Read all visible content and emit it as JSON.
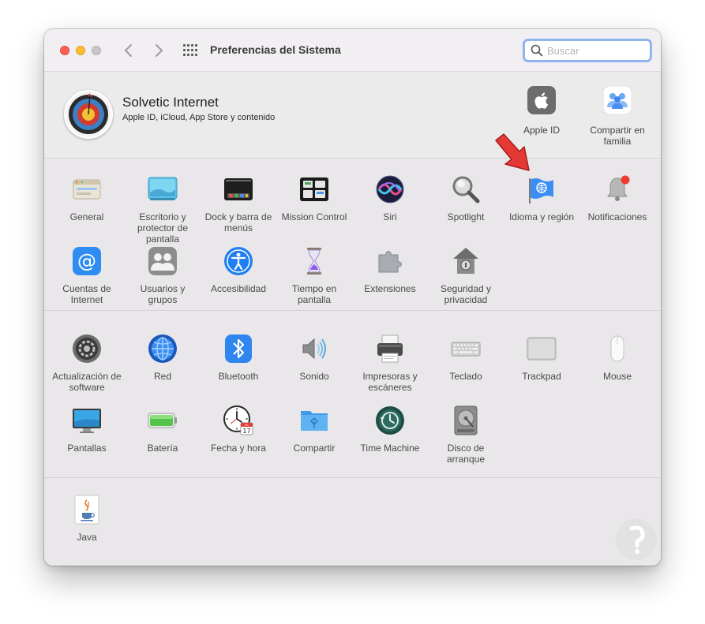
{
  "window": {
    "title": "Preferencias del Sistema",
    "search": {
      "placeholder": "Buscar",
      "value": ""
    }
  },
  "account": {
    "name": "Solvetic Internet",
    "subtitle": "Apple ID, iCloud, App Store y contenido",
    "items": [
      {
        "label": "Apple ID",
        "icon": "apple-icon"
      },
      {
        "label": "Compartir en familia",
        "icon": "family-icon"
      }
    ]
  },
  "sections": [
    {
      "items": [
        {
          "label": "General",
          "icon": "general-icon"
        },
        {
          "label": "Escritorio y protector de pantalla",
          "icon": "desktop-icon"
        },
        {
          "label": "Dock y barra de menús",
          "icon": "dock-icon"
        },
        {
          "label": "Mission Control",
          "icon": "mission-control-icon"
        },
        {
          "label": "Siri",
          "icon": "siri-icon"
        },
        {
          "label": "Spotlight",
          "icon": "spotlight-icon"
        },
        {
          "label": "Idioma y región",
          "icon": "language-region-icon"
        },
        {
          "label": "Notificaciones",
          "icon": "notifications-icon"
        },
        {
          "label": "Cuentas de Internet",
          "icon": "internet-accounts-icon"
        },
        {
          "label": "Usuarios y grupos",
          "icon": "users-groups-icon"
        },
        {
          "label": "Accesibilidad",
          "icon": "accessibility-icon"
        },
        {
          "label": "Tiempo en pantalla",
          "icon": "screen-time-icon"
        },
        {
          "label": "Extensiones",
          "icon": "extensions-icon"
        },
        {
          "label": "Seguridad y privacidad",
          "icon": "security-icon"
        }
      ]
    },
    {
      "items": [
        {
          "label": "Actualización de software",
          "icon": "software-update-icon"
        },
        {
          "label": "Red",
          "icon": "network-icon"
        },
        {
          "label": "Bluetooth",
          "icon": "bluetooth-icon"
        },
        {
          "label": "Sonido",
          "icon": "sound-icon"
        },
        {
          "label": "Impresoras y escáneres",
          "icon": "printer-icon"
        },
        {
          "label": "Teclado",
          "icon": "keyboard-icon"
        },
        {
          "label": "Trackpad",
          "icon": "trackpad-icon"
        },
        {
          "label": "Mouse",
          "icon": "mouse-icon"
        },
        {
          "label": "Pantallas",
          "icon": "displays-icon"
        },
        {
          "label": "Batería",
          "icon": "battery-icon"
        },
        {
          "label": "Fecha y hora",
          "icon": "date-time-icon"
        },
        {
          "label": "Compartir",
          "icon": "sharing-icon"
        },
        {
          "label": "Time Machine",
          "icon": "time-machine-icon"
        },
        {
          "label": "Disco de arranque",
          "icon": "startup-disk-icon"
        }
      ]
    },
    {
      "items": [
        {
          "label": "Java",
          "icon": "java-icon"
        }
      ]
    }
  ],
  "calendar": {
    "month": "JUL",
    "day": "17"
  },
  "colors": {
    "accent": "#3478f6",
    "highlight_arrow": "#e53935"
  }
}
